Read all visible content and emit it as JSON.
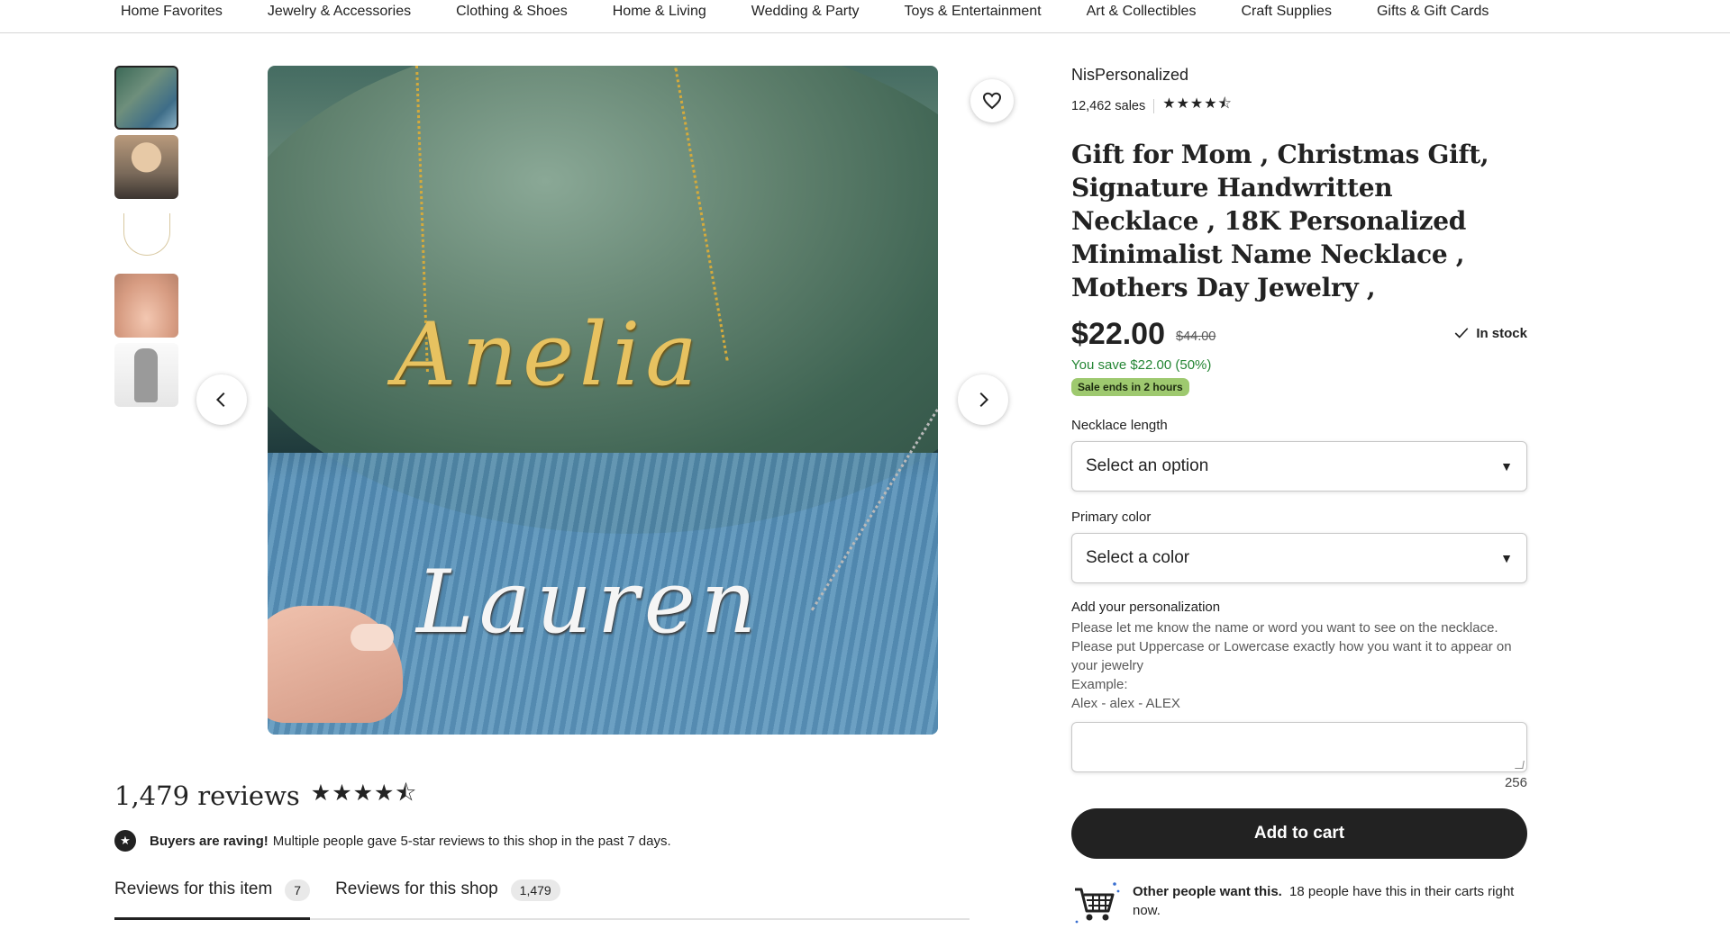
{
  "nav": {
    "categories": [
      "Home Favorites",
      "Jewelry & Accessories",
      "Clothing & Shoes",
      "Home & Living",
      "Wedding & Party",
      "Toys & Entertainment",
      "Art & Collectibles",
      "Craft Supplies",
      "Gifts & Gift Cards"
    ]
  },
  "gallery": {
    "thumbnail_count": 5,
    "active_index": 0,
    "main_image_names": [
      "Anelia",
      "Lauren"
    ]
  },
  "shop": {
    "name": "NisPersonalized",
    "sales": "12,462 sales",
    "rating": 4.5,
    "stars": "★★★★⯪"
  },
  "listing": {
    "title": "Gift for Mom , Christmas Gift, Signature Handwritten Necklace , 18K Personalized Minimalist Name Necklace , Mothers Day Jewelry ,",
    "price": "$22.00",
    "original_price": "$44.00",
    "stock": "In stock",
    "savings": "You save $22.00 (50%)",
    "sale_badge": "Sale ends in 2 hours"
  },
  "options": {
    "length_label": "Necklace length",
    "length_value": "Select an option",
    "color_label": "Primary color",
    "color_value": "Select a color"
  },
  "personalization": {
    "label": "Add your personalization",
    "help_lines": [
      "Please let me know the name or word you want to see on the necklace.",
      "Please put Uppercase or Lowercase exactly how you want it to appear on your jewelry",
      "Example:",
      "Alex - alex - ALEX"
    ],
    "value": "",
    "char_count": "256"
  },
  "actions": {
    "add_to_cart": "Add to cart"
  },
  "demand": {
    "bold": "Other people want this.",
    "rest": "18 people have this in their carts right now."
  },
  "reviews": {
    "count": "1,479 reviews",
    "stars": "★★★★⯪",
    "raving_bold": "Buyers are raving!",
    "raving_rest": "Multiple people gave 5-star reviews to this shop in the past 7 days.",
    "tab_item_label": "Reviews for this item",
    "tab_item_count": "7",
    "tab_shop_label": "Reviews for this shop",
    "tab_shop_count": "1,479"
  },
  "colors": {
    "text": "#222222",
    "save_green": "#258635",
    "sale_badge_bg": "#9ec96f",
    "button_bg": "#222222"
  }
}
